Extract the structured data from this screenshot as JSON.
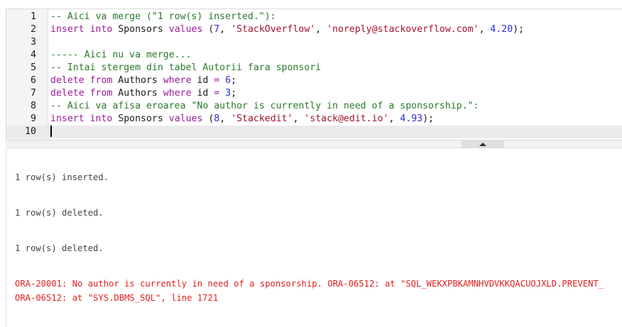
{
  "editor": {
    "lines": [
      {
        "n": "1",
        "tokens": [
          {
            "t": "-- Aici va merge (\"1 row(s) inserted.\"):",
            "c": "com"
          }
        ]
      },
      {
        "n": "2",
        "tokens": [
          {
            "t": "insert into",
            "c": "kw"
          },
          {
            "t": " Sponsors ",
            "c": "id"
          },
          {
            "t": "values",
            "c": "kw"
          },
          {
            "t": " (",
            "c": "id"
          },
          {
            "t": "7",
            "c": "num"
          },
          {
            "t": ", ",
            "c": "id"
          },
          {
            "t": "'StackOverflow'",
            "c": "str"
          },
          {
            "t": ", ",
            "c": "id"
          },
          {
            "t": "'noreply@stackoverflow.com'",
            "c": "str"
          },
          {
            "t": ", ",
            "c": "id"
          },
          {
            "t": "4.20",
            "c": "num"
          },
          {
            "t": ");",
            "c": "id"
          }
        ]
      },
      {
        "n": "3",
        "tokens": []
      },
      {
        "n": "4",
        "tokens": [
          {
            "t": "----- Aici nu va merge...",
            "c": "com"
          }
        ]
      },
      {
        "n": "5",
        "tokens": [
          {
            "t": "-- Intai stergem din tabel Autorii fara sponsori",
            "c": "com"
          }
        ]
      },
      {
        "n": "6",
        "tokens": [
          {
            "t": "delete from",
            "c": "kw"
          },
          {
            "t": " Authors ",
            "c": "id"
          },
          {
            "t": "where",
            "c": "kw"
          },
          {
            "t": " id ",
            "c": "id"
          },
          {
            "t": "=",
            "c": "kw"
          },
          {
            "t": " ",
            "c": "id"
          },
          {
            "t": "6",
            "c": "num"
          },
          {
            "t": ";",
            "c": "id"
          }
        ]
      },
      {
        "n": "7",
        "tokens": [
          {
            "t": "delete from",
            "c": "kw"
          },
          {
            "t": " Authors ",
            "c": "id"
          },
          {
            "t": "where",
            "c": "kw"
          },
          {
            "t": " id ",
            "c": "id"
          },
          {
            "t": "=",
            "c": "kw"
          },
          {
            "t": " ",
            "c": "id"
          },
          {
            "t": "3",
            "c": "num"
          },
          {
            "t": ";",
            "c": "id"
          }
        ]
      },
      {
        "n": "8",
        "tokens": [
          {
            "t": "-- Aici va afisa eroarea \"No author is currently in need of a sponsorship.\":",
            "c": "com"
          }
        ]
      },
      {
        "n": "9",
        "tokens": [
          {
            "t": "insert into",
            "c": "kw"
          },
          {
            "t": " Sponsors ",
            "c": "id"
          },
          {
            "t": "values",
            "c": "kw"
          },
          {
            "t": " (",
            "c": "id"
          },
          {
            "t": "8",
            "c": "num"
          },
          {
            "t": ", ",
            "c": "id"
          },
          {
            "t": "'Stackedit'",
            "c": "str"
          },
          {
            "t": ", ",
            "c": "id"
          },
          {
            "t": "'stack@edit.io'",
            "c": "str"
          },
          {
            "t": ", ",
            "c": "id"
          },
          {
            "t": "4.93",
            "c": "num"
          },
          {
            "t": ");",
            "c": "id"
          }
        ]
      },
      {
        "n": "10",
        "tokens": [],
        "active": true,
        "cursor": true
      }
    ]
  },
  "results": {
    "messages": [
      {
        "text": "1 row(s) inserted.",
        "type": "info"
      },
      {
        "text": "1 row(s) deleted.",
        "type": "info"
      },
      {
        "text": "1 row(s) deleted.",
        "type": "info"
      },
      {
        "text": "ORA-20001: No author is currently in need of a sponsorship. ORA-06512: at \"SQL_WEKXPBKAMNHVDVKKQACUOJXLD.PREVENT_",
        "type": "error"
      },
      {
        "text": "ORA-06512: at \"SYS.DBMS_SQL\", line 1721",
        "type": "error"
      }
    ]
  },
  "colors": {
    "keyword": "#9b1b9b",
    "comment": "#2a7a2a",
    "string": "#a3152c",
    "number": "#2b2bd6",
    "error": "#e02020"
  }
}
